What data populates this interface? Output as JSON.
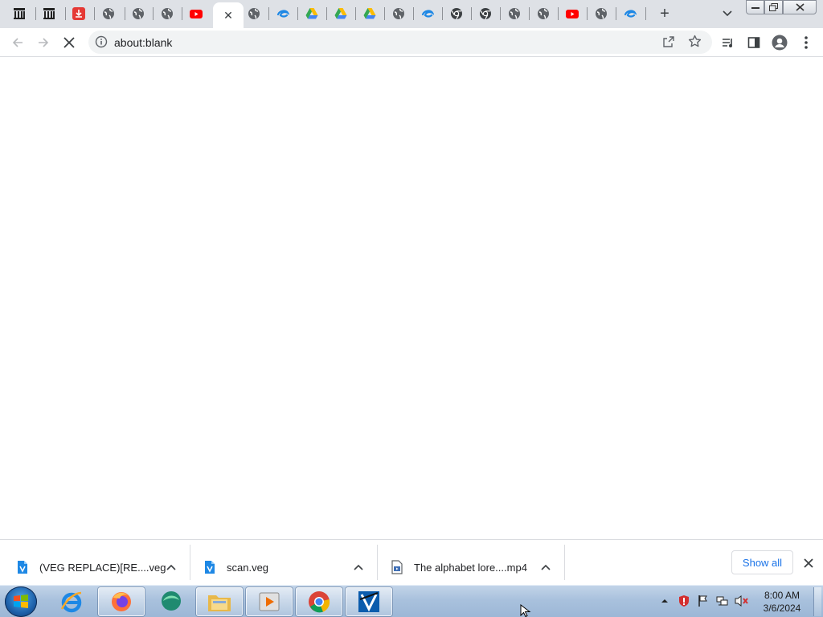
{
  "browser": {
    "tabs": [
      {
        "icon": "archive-icon",
        "active": false
      },
      {
        "icon": "archive-icon",
        "active": false
      },
      {
        "icon": "download-red-icon",
        "active": false
      },
      {
        "icon": "globe-icon",
        "active": false
      },
      {
        "icon": "globe-icon",
        "active": false
      },
      {
        "icon": "globe-icon",
        "active": false
      },
      {
        "icon": "youtube-icon",
        "active": false
      },
      {
        "icon": "loading-icon",
        "active": true
      },
      {
        "icon": "globe-icon",
        "active": false
      },
      {
        "icon": "blue-swirl-icon",
        "active": false
      },
      {
        "icon": "google-drive-icon",
        "active": false
      },
      {
        "icon": "google-drive-icon",
        "active": false
      },
      {
        "icon": "google-drive-icon",
        "active": false
      },
      {
        "icon": "globe-icon",
        "active": false
      },
      {
        "icon": "blue-swirl-icon",
        "active": false
      },
      {
        "icon": "chrome-icon",
        "active": false
      },
      {
        "icon": "chrome-icon",
        "active": false
      },
      {
        "icon": "globe-icon",
        "active": false
      },
      {
        "icon": "globe-icon",
        "active": false
      },
      {
        "icon": "youtube-icon",
        "active": false
      },
      {
        "icon": "globe-icon",
        "active": false
      },
      {
        "icon": "blue-swirl-icon",
        "active": false
      }
    ],
    "active_tab_close": "✕",
    "new_tab_label": "+",
    "address": "about:blank",
    "colors": {
      "tabstrip_bg": "#dee1e6",
      "omnibox_bg": "#f1f3f4",
      "accent": "#1a73e8"
    }
  },
  "downloads": {
    "items": [
      {
        "name": "(VEG REPLACE)[RE....veg",
        "icon": "vegas-file-icon"
      },
      {
        "name": "scan.veg",
        "icon": "vegas-file-icon"
      },
      {
        "name": "The alphabet lore....mp4",
        "icon": "video-file-icon"
      }
    ],
    "show_all": "Show all"
  },
  "taskbar": {
    "apps": [
      {
        "name": "internet-explorer-icon",
        "running": false
      },
      {
        "name": "firefox-icon",
        "running": true
      },
      {
        "name": "messenger-icon",
        "running": false
      },
      {
        "name": "file-explorer-icon",
        "running": true
      },
      {
        "name": "media-player-icon",
        "running": true
      },
      {
        "name": "chrome-icon",
        "running": true
      },
      {
        "name": "vegas-pro-icon",
        "running": true
      }
    ],
    "clock": {
      "time": "8:00 AM",
      "date": "3/6/2024"
    }
  }
}
